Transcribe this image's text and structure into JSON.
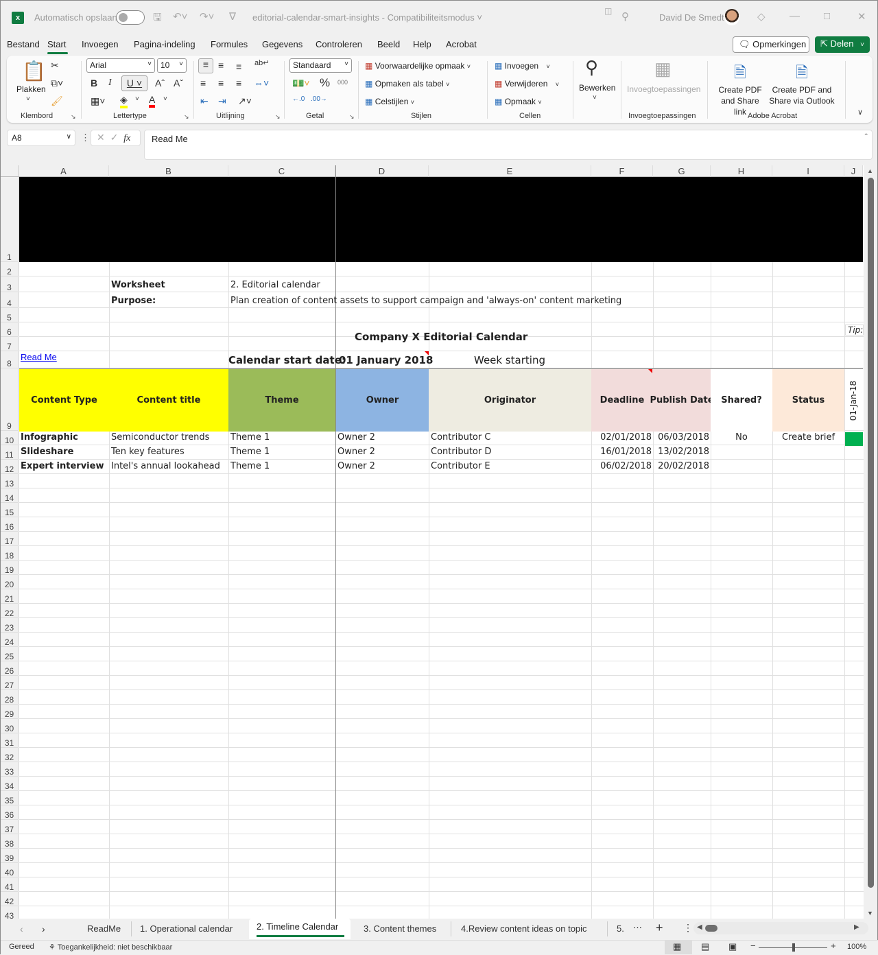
{
  "titlebar": {
    "autosave_label": "Automatisch opslaan",
    "filename": "editorial-calendar-smart-insights",
    "separator": "-",
    "mode": "Compatibiliteitsmodus",
    "user_name": "David De Smedt"
  },
  "menu": {
    "items": [
      "Bestand",
      "Start",
      "Invoegen",
      "Pagina-indeling",
      "Formules",
      "Gegevens",
      "Controleren",
      "Beeld",
      "Help",
      "Acrobat"
    ],
    "active": "Start",
    "comments_label": "Opmerkingen",
    "share_label": "Delen"
  },
  "ribbon": {
    "clipboard": {
      "paste_label": "Plakken",
      "group_label": "Klembord"
    },
    "font": {
      "font_name": "Arial",
      "font_size": "10",
      "group_label": "Lettertype",
      "highlight_color": "#ffff00",
      "font_color": "#ff0000"
    },
    "alignment": {
      "group_label": "Uitlijning"
    },
    "number": {
      "format": "Standaard",
      "group_label": "Getal"
    },
    "styles": {
      "conditional": "Voorwaardelijke opmaak",
      "as_table": "Opmaken als tabel",
      "cell_styles": "Celstijlen",
      "group_label": "Stijlen"
    },
    "cells": {
      "insert": "Invoegen",
      "delete": "Verwijderen",
      "format": "Opmaak",
      "group_label": "Cellen"
    },
    "editing": {
      "label": "Bewerken"
    },
    "addins": {
      "label": "Invoegtoepassingen",
      "group_label": "Invoegtoepassingen"
    },
    "acrobat": {
      "pdf_link_1": "Create PDF",
      "pdf_link_2": "and Share link",
      "pdf_outlook_1": "Create PDF and",
      "pdf_outlook_2": "Share via Outlook",
      "group_label": "Adobe Acrobat"
    }
  },
  "formula_bar": {
    "name_box": "A8",
    "formula": "Read Me"
  },
  "columns": [
    "A",
    "B",
    "C",
    "D",
    "E",
    "F",
    "G",
    "H",
    "I",
    "J"
  ],
  "rows": [
    "1",
    "2",
    "3",
    "4",
    "5",
    "6",
    "7",
    "8",
    "9",
    "10",
    "11",
    "12",
    "13",
    "14",
    "15",
    "16",
    "17",
    "18",
    "19",
    "20",
    "21",
    "22",
    "23",
    "24",
    "25",
    "26",
    "27",
    "28",
    "29",
    "30",
    "31",
    "32",
    "33",
    "34",
    "35",
    "36",
    "37",
    "38",
    "39",
    "40",
    "41",
    "42",
    "43"
  ],
  "sheet": {
    "worksheet_label": "Worksheet",
    "worksheet_value": "2. Editorial calendar",
    "purpose_label": "Purpose:",
    "purpose_value": "Plan creation of content assets to support campaign and 'always-on' content marketing",
    "title": "Company X Editorial Calendar",
    "tip": "Tip:",
    "read_me_link": "Read Me",
    "start_date_label": "Calendar start date:",
    "start_date_value": "01 January 2018",
    "week_starting": "Week starting",
    "headers": [
      "Content Type",
      "Content title",
      "Theme",
      "Owner",
      "Originator",
      "Deadline",
      "Publish Date",
      "Shared?",
      "Status"
    ],
    "header_colors": {
      "content": "#ffff00",
      "theme": "#9bbb59",
      "owner": "#8db4e2",
      "originator": "#eeece1",
      "dates": "#f2dcdb",
      "status": "#fde9d9"
    },
    "week_column_date": "01-Jan-18",
    "week_marker_color": "#00b050",
    "data_rows": [
      {
        "type": "Infographic",
        "title": "Semiconductor trends",
        "theme": "Theme 1",
        "owner": "Owner 2",
        "originator": "Contributor C",
        "deadline": "02/01/2018",
        "publish": "06/03/2018",
        "shared": "No",
        "status": "Create brief"
      },
      {
        "type": "Slideshare",
        "title": "Ten key features",
        "theme": "Theme 1",
        "owner": "Owner 2",
        "originator": "Contributor D",
        "deadline": "16/01/2018",
        "publish": "13/02/2018",
        "shared": "",
        "status": ""
      },
      {
        "type": "Expert interview",
        "title": "Intel's annual lookahead",
        "theme": "Theme 1",
        "owner": "Owner 2",
        "originator": "Contributor E",
        "deadline": "06/02/2018",
        "publish": "20/02/2018",
        "shared": "",
        "status": ""
      }
    ]
  },
  "tabs": {
    "items": [
      "ReadMe",
      "1. Operational calendar",
      "2. Timeline Calendar",
      "3. Content themes",
      "4.Review content ideas on topic",
      "5."
    ],
    "active": "2. Timeline Calendar"
  },
  "status_bar": {
    "ready": "Gereed",
    "accessibility": "Toegankelijkheid: niet beschikbaar",
    "zoom": "100%"
  }
}
